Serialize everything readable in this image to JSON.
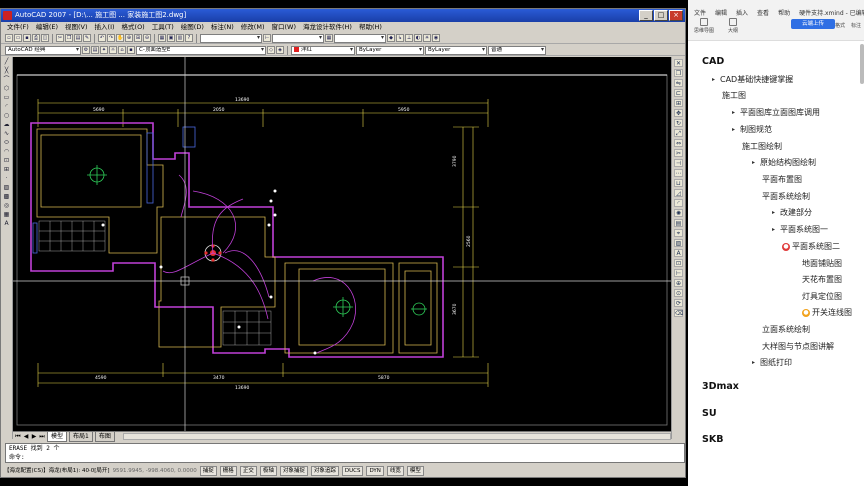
{
  "autocad": {
    "title": "AutoCAD 2007 - [D:\\... 施工图 ... 家装施工图2.dwg]",
    "menu": [
      "文件(F)",
      "编辑(E)",
      "视图(V)",
      "插入(I)",
      "格式(O)",
      "工具(T)",
      "绘图(D)",
      "标注(N)",
      "修改(M)",
      "窗口(W)",
      "海龙设计软件(H)",
      "帮助(H)"
    ],
    "workspace": "AutoCAD 经典",
    "style_combo": "C-顶面造型E",
    "layer_combo": "洋红",
    "linetype_combo": "ByLayer",
    "lineweight_combo": "ByLayer",
    "plotstyle_combo": "普通",
    "layout_tabs": [
      "模型",
      "布局1",
      "布图"
    ],
    "command_history": "ERASE 找到 2 个",
    "command_prompt": "命令:",
    "status_left": "【海龙配置(CS)】海龙(布局1): 40·0[局开]",
    "coords": "9591.9945, -998.4060, 0.0000",
    "status_buttons": [
      "捕捉",
      "栅格",
      "正交",
      "极轴",
      "对象捕捉",
      "对象追踪",
      "DUCS",
      "DYN",
      "线宽",
      "模型"
    ],
    "dims": {
      "top_total": "13690",
      "top_left": "5690",
      "top_mid": "2050",
      "top_right": "5950",
      "bottom_total": "13690",
      "bottom_a": "4590",
      "bottom_b": "3470",
      "bottom_c": "5870",
      "right_a": "3790",
      "right_b": "2560",
      "right_c": "3670"
    }
  },
  "xmind": {
    "menu": [
      "文件",
      "编辑",
      "插入",
      "查看",
      "帮助",
      "硬件支持.xmind - 已编辑"
    ],
    "tools": [
      "思维导图",
      "大纲"
    ],
    "share_label": "云端上传",
    "right_tools": [
      "格式",
      "标注"
    ],
    "outline": [
      {
        "label": "CAD",
        "level": 0
      },
      {
        "label": "CAD基础快捷键掌握",
        "level": 1,
        "arrow": true
      },
      {
        "label": "施工图",
        "level": 1
      },
      {
        "label": "平面图库立面图库调用",
        "level": 2,
        "arrow": true
      },
      {
        "label": "制图规范",
        "level": 2,
        "arrow": true
      },
      {
        "label": "施工图绘制",
        "level": 2
      },
      {
        "label": "原始结构图绘制",
        "level": 3,
        "arrow": true
      },
      {
        "label": "平面布置图",
        "level": 3
      },
      {
        "label": "平面系统绘制",
        "level": 3
      },
      {
        "label": "改建部分",
        "level": 4,
        "arrow": true
      },
      {
        "label": "平面系统图一",
        "level": 4,
        "arrow": true
      },
      {
        "label": "平面系统图二",
        "level": 5,
        "marker": "red"
      },
      {
        "label": "地面铺贴图",
        "level": 6
      },
      {
        "label": "天花布置图",
        "level": 6
      },
      {
        "label": "灯具定位图",
        "level": 6
      },
      {
        "label": "开关连线图",
        "level": 6,
        "marker": "orange"
      },
      {
        "label": "立面系统绘制",
        "level": 3
      },
      {
        "label": "大样图与节点图讲解",
        "level": 3
      },
      {
        "label": "图纸打印",
        "level": 3,
        "arrow": true
      },
      {
        "label": "3Dmax",
        "level": 0
      },
      {
        "label": "SU",
        "level": 0
      },
      {
        "label": "SKB",
        "level": 0
      }
    ]
  }
}
